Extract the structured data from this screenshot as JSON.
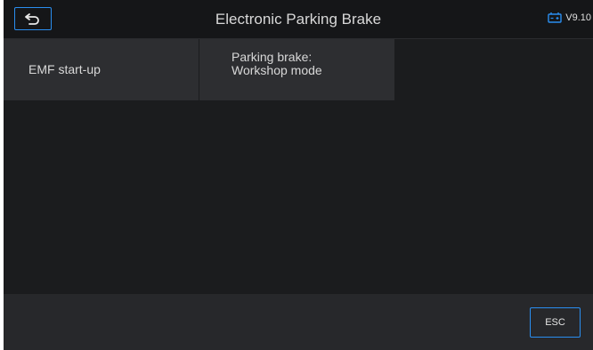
{
  "header": {
    "title": "Electronic Parking Brake",
    "back_icon": "back-arrow-icon",
    "battery_icon": "battery-icon",
    "version": "V9.10"
  },
  "tiles": [
    {
      "label": "EMF start-up"
    },
    {
      "label": "Parking brake:\nWorkshop mode"
    }
  ],
  "footer": {
    "esc_label": "ESC"
  },
  "colors": {
    "accent": "#2a8ef0",
    "background": "#1b1c1e",
    "tile": "#2d2e31",
    "footer": "#27282b"
  }
}
